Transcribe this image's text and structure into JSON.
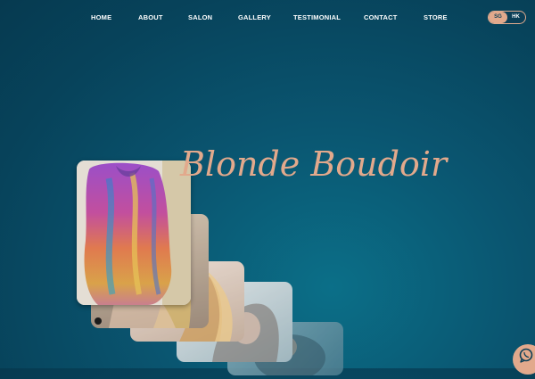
{
  "nav": {
    "items": [
      "HOME",
      "ABOUT",
      "SALON",
      "GALLERY",
      "TESTIMONIAL",
      "CONTACT",
      "STORE"
    ]
  },
  "lang": {
    "options": [
      "SG",
      "HK"
    ],
    "selected": "SG"
  },
  "brand": {
    "name": "Blonde Boudoir"
  },
  "colors": {
    "accent": "#e2a98c",
    "background": "#07435b",
    "text": "#ffffff"
  },
  "icons": {
    "whatsapp": "whatsapp-icon",
    "instagram": "instagram-icon"
  }
}
